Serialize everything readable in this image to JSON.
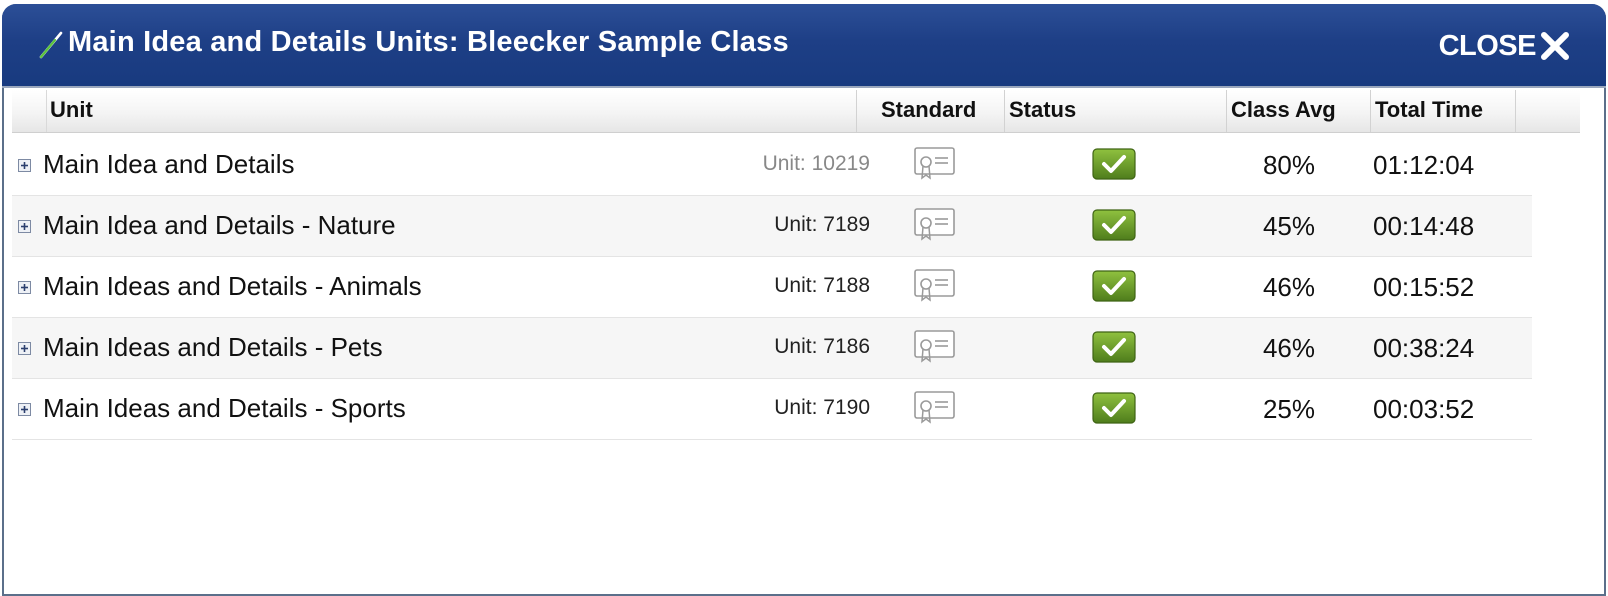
{
  "dialog": {
    "title": "Main Idea and Details Units: Bleecker Sample Class",
    "close_label": "CLOSE"
  },
  "columns": {
    "unit": "Unit",
    "standard": "Standard",
    "status": "Status",
    "class_avg": "Class Avg",
    "total_time": "Total Time"
  },
  "rows": [
    {
      "name": "Main Idea and Details",
      "unit_id": "Unit: 10219",
      "status": "complete",
      "class_avg": "80%",
      "total_time": "01:12:04"
    },
    {
      "name": "Main Idea and Details - Nature",
      "unit_id": "Unit: 7189",
      "status": "complete",
      "class_avg": "45%",
      "total_time": "00:14:48"
    },
    {
      "name": "Main Ideas and Details - Animals",
      "unit_id": "Unit: 7188",
      "status": "complete",
      "class_avg": "46%",
      "total_time": "00:15:52"
    },
    {
      "name": "Main Ideas and Details - Pets",
      "unit_id": "Unit: 7186",
      "status": "complete",
      "class_avg": "46%",
      "total_time": "00:38:24"
    },
    {
      "name": "Main Ideas and Details - Sports",
      "unit_id": "Unit: 7190",
      "status": "complete",
      "class_avg": "25%",
      "total_time": "00:03:52"
    }
  ],
  "icons": {
    "title": "pencil-icon",
    "close": "close-icon",
    "expand": "expand-plus-icon",
    "standard": "certificate-icon",
    "status": "checkmark-icon"
  },
  "colors": {
    "titlebar": "#1e3f86",
    "status_green": "#6b9a2a",
    "pencil_green": "#4caf3a"
  }
}
